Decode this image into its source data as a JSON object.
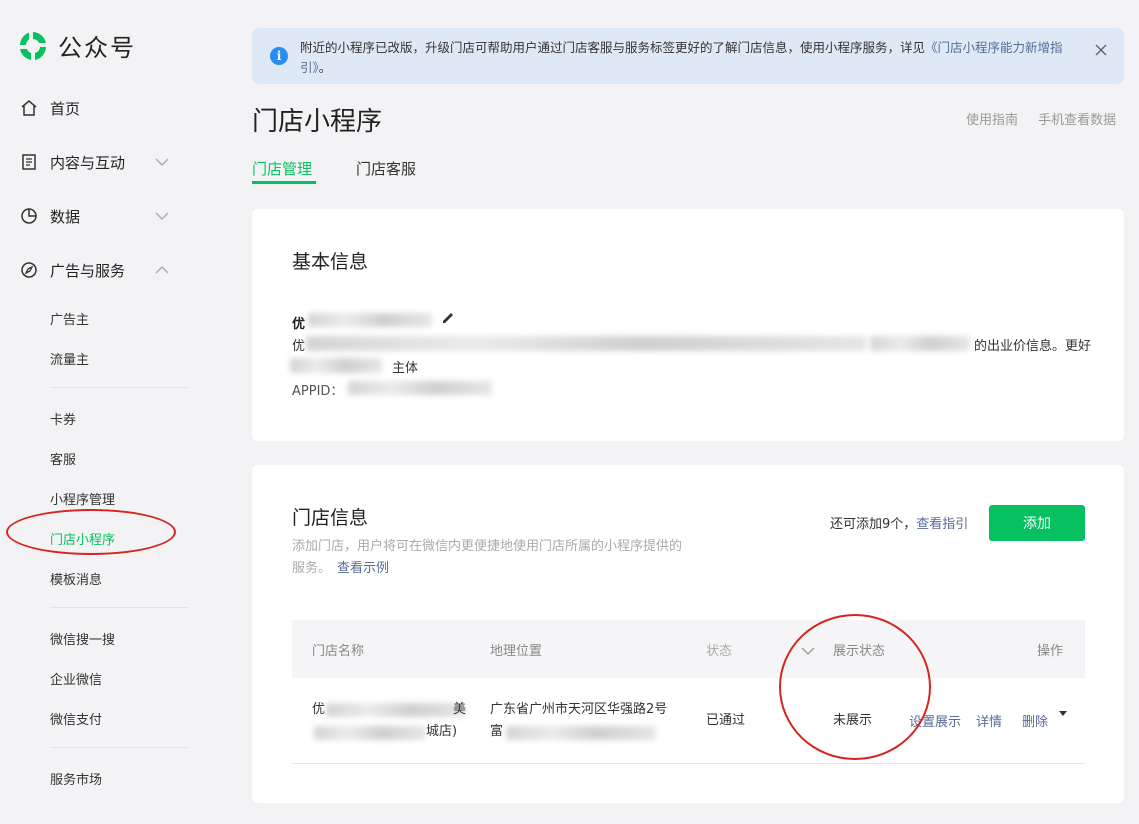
{
  "brand": {
    "name": "公众号",
    "accent": "#07c160"
  },
  "sidebar": {
    "main_items": [
      {
        "label": "首页",
        "icon": "home-icon"
      },
      {
        "label": "内容与互动",
        "icon": "document-icon",
        "expandable": true
      },
      {
        "label": "数据",
        "icon": "pie-chart-icon",
        "expandable": true
      },
      {
        "label": "广告与服务",
        "icon": "compass-icon",
        "expanded": true
      }
    ],
    "sub_items": [
      {
        "label": "广告主"
      },
      {
        "label": "流量主"
      },
      {
        "label": "卡券"
      },
      {
        "label": "客服"
      },
      {
        "label": "小程序管理"
      },
      {
        "label": "门店小程序",
        "active": true
      },
      {
        "label": "模板消息"
      },
      {
        "label": "微信搜一搜"
      },
      {
        "label": "企业微信"
      },
      {
        "label": "微信支付"
      },
      {
        "label": "服务市场"
      }
    ]
  },
  "notice": {
    "text": "附近的小程序已改版，升级门店可帮助用户通过门店客服与服务标签更好的了解门店信息，使用小程序服务，详见",
    "link": "《门店小程序能力新增指引》",
    "suffix": "。",
    "icon": "info-icon"
  },
  "page": {
    "title": "门店小程序",
    "header_links": [
      "使用指南",
      "手机查看数据"
    ],
    "tabs": [
      {
        "label": "门店管理",
        "active": true
      },
      {
        "label": "门店客服"
      }
    ]
  },
  "basic_info": {
    "title": "基本信息",
    "name_prefix": "优",
    "desc_prefix": "优",
    "desc_suffix": "的出业价信息。更好",
    "subject_suffix": "主体",
    "appid_label": "APPID："
  },
  "store_info": {
    "title": "门店信息",
    "description": "添加门店，用户将可在微信内更便捷地使用门店所属的小程序提供的服务。",
    "example_link": "查看示例",
    "quota_text": "还可添加9个，",
    "quota_link": "查看指引",
    "add_button": "添加",
    "table": {
      "columns": [
        "门店名称",
        "地理位置",
        "状态",
        "展示状态",
        "操作"
      ],
      "rows": [
        {
          "name_part_a": "优",
          "name_part_b": "美",
          "name_part_c": "城店)",
          "location": "广东省广州市天河区华强路2号",
          "location_tail": "富",
          "status": "已通过",
          "display_status": "未展示",
          "actions": [
            "设置展示",
            "详情",
            "删除"
          ]
        }
      ]
    }
  }
}
